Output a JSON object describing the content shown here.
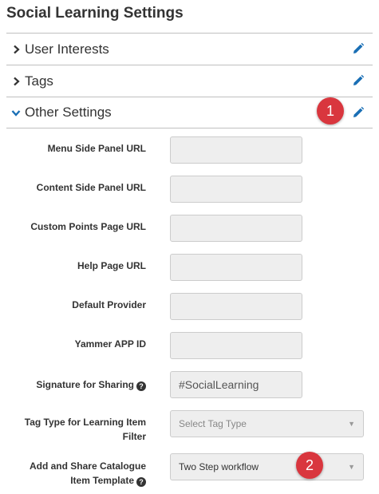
{
  "page": {
    "title": "Social Learning Settings"
  },
  "sections": [
    {
      "label": "User Interests",
      "expanded": false
    },
    {
      "label": "Tags",
      "expanded": false
    },
    {
      "label": "Other Settings",
      "expanded": true
    }
  ],
  "colors": {
    "accent": "#1a6fb5",
    "badge": "#d9363e",
    "field_bg": "#eeeeee"
  },
  "badges": {
    "one": "1",
    "two": "2"
  },
  "fields": {
    "menu_side_panel_url": {
      "label": "Menu Side Panel URL",
      "value": ""
    },
    "content_side_panel_url": {
      "label": "Content Side Panel URL",
      "value": ""
    },
    "custom_points_page_url": {
      "label": "Custom Points Page URL",
      "value": ""
    },
    "help_page_url": {
      "label": "Help Page URL",
      "value": ""
    },
    "default_provider": {
      "label": "Default Provider",
      "value": ""
    },
    "yammer_app_id": {
      "label": "Yammer APP ID",
      "value": ""
    },
    "signature_for_sharing": {
      "label": "Signature for Sharing",
      "value": "#SocialLearning"
    },
    "tag_type": {
      "label_line1": "Tag Type for Learning Item",
      "label_line2": "Filter",
      "value": "Select Tag Type"
    },
    "catalogue_template": {
      "label_line1": "Add and Share Catalogue",
      "label_line2": "Item Template",
      "value": "Two Step workflow"
    }
  },
  "icons": {
    "collapsed": "chevron-right-icon",
    "expanded": "chevron-down-icon",
    "edit": "pencil-icon",
    "help": "question-circle-icon"
  }
}
